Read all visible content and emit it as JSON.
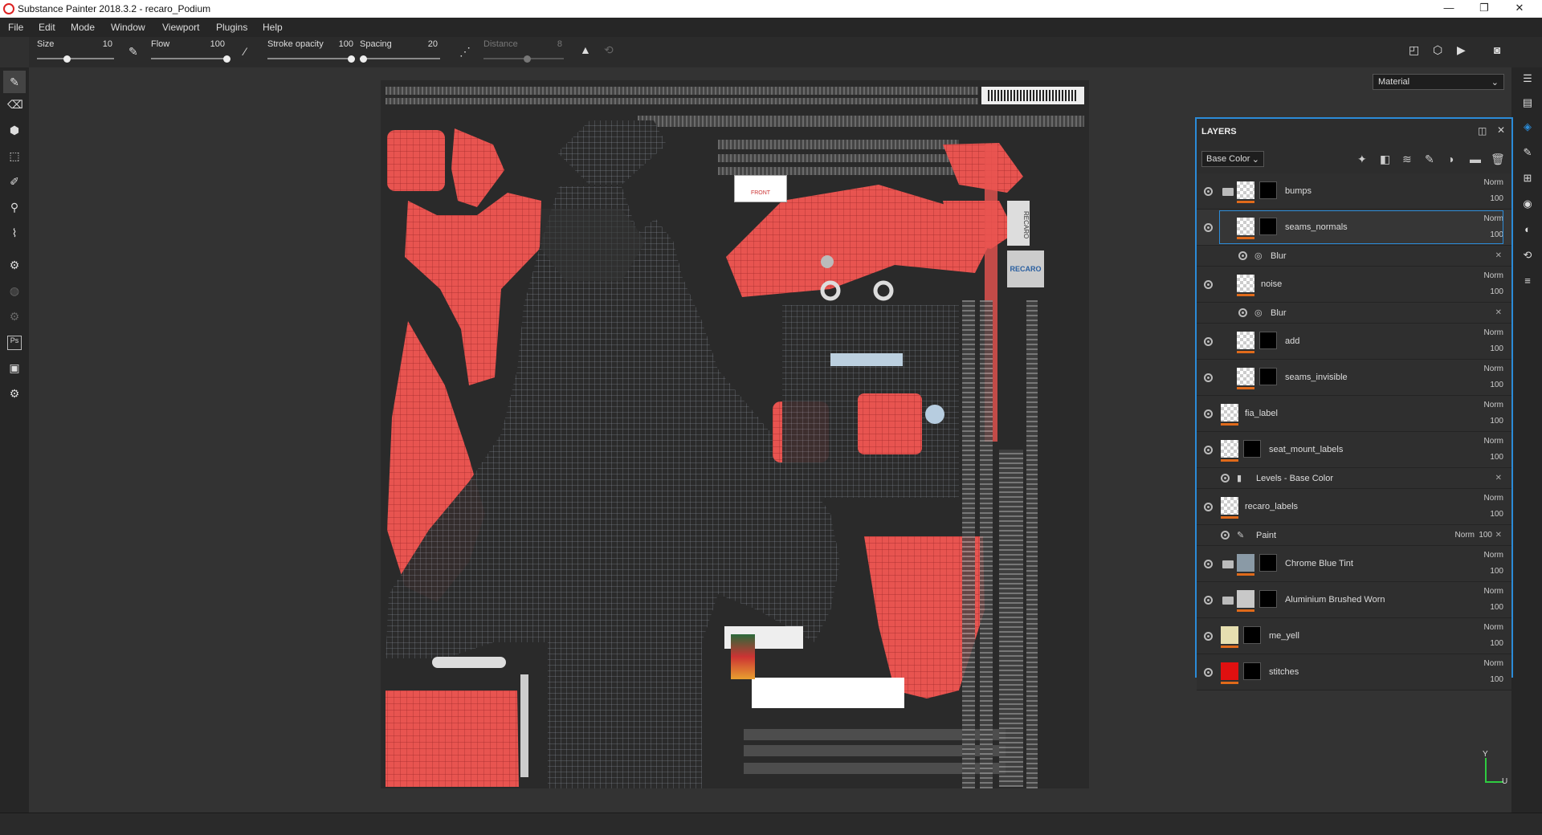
{
  "window": {
    "title": "Substance Painter 2018.3.2 - recaro_Podium",
    "minimize": "—",
    "maximize": "❐",
    "close": "✕"
  },
  "menu": [
    "File",
    "Edit",
    "Mode",
    "Window",
    "Viewport",
    "Plugins",
    "Help"
  ],
  "tool_options": {
    "size_label": "Size",
    "size_value": "10",
    "flow_label": "Flow",
    "flow_value": "100",
    "stroke_label": "Stroke opacity",
    "stroke_value": "100",
    "spacing_label": "Spacing",
    "spacing_value": "20",
    "distance_label": "Distance",
    "distance_value": "8"
  },
  "viewport_mode": "Material",
  "layers_panel": {
    "title": "LAYERS",
    "channel": "Base Color",
    "layers": [
      {
        "name": "bumps",
        "blend": "Norm",
        "opacity": "100",
        "type": "folder",
        "thumb": "checker",
        "mask": true
      },
      {
        "name": "seams_normals",
        "blend": "Norm",
        "opacity": "100",
        "type": "fill",
        "thumb": "checker",
        "mask": true,
        "selected": true
      },
      {
        "name": "Blur",
        "type": "effect",
        "indent": true
      },
      {
        "name": "noise",
        "blend": "Norm",
        "opacity": "100",
        "type": "fill",
        "thumb": "checker",
        "mask": false
      },
      {
        "name": "Blur",
        "type": "effect",
        "indent": true
      },
      {
        "name": "add",
        "blend": "Norm",
        "opacity": "100",
        "type": "fill",
        "thumb": "checker",
        "mask": true
      },
      {
        "name": "seams_invisible",
        "blend": "Norm",
        "opacity": "100",
        "type": "fill",
        "thumb": "checker",
        "mask": true
      },
      {
        "name": "fia_label",
        "blend": "Norm",
        "opacity": "100",
        "type": "paint",
        "thumb": "checker",
        "mask": false
      },
      {
        "name": "seat_mount_labels",
        "blend": "Norm",
        "opacity": "100",
        "type": "paint",
        "thumb": "checker",
        "mask": true
      },
      {
        "name": "Levels - Base Color",
        "type": "effect"
      },
      {
        "name": "recaro_labels",
        "blend": "Norm",
        "opacity": "100",
        "type": "paint",
        "thumb": "checker",
        "mask": false
      },
      {
        "name": "Paint",
        "type": "paint-effect",
        "blend": "Norm",
        "opacity": "100"
      },
      {
        "name": "Chrome Blue Tint",
        "blend": "Norm",
        "opacity": "100",
        "type": "folder",
        "thumb": "#8a9aa6",
        "mask": true
      },
      {
        "name": "Aluminium Brushed Worn",
        "blend": "Norm",
        "opacity": "100",
        "type": "folder",
        "thumb": "#c8c8c8",
        "mask": true
      },
      {
        "name": "me_yell",
        "blend": "Norm",
        "opacity": "100",
        "type": "paint",
        "thumb": "#e6dfb0",
        "mask": true
      },
      {
        "name": "stitches",
        "blend": "Norm",
        "opacity": "100",
        "type": "paint",
        "thumb": "#e01010",
        "mask": true
      }
    ]
  },
  "uv_labels": {
    "front": "FRONT",
    "recaro": "RECARO"
  },
  "axes": {
    "y": "Y",
    "u": "U"
  }
}
